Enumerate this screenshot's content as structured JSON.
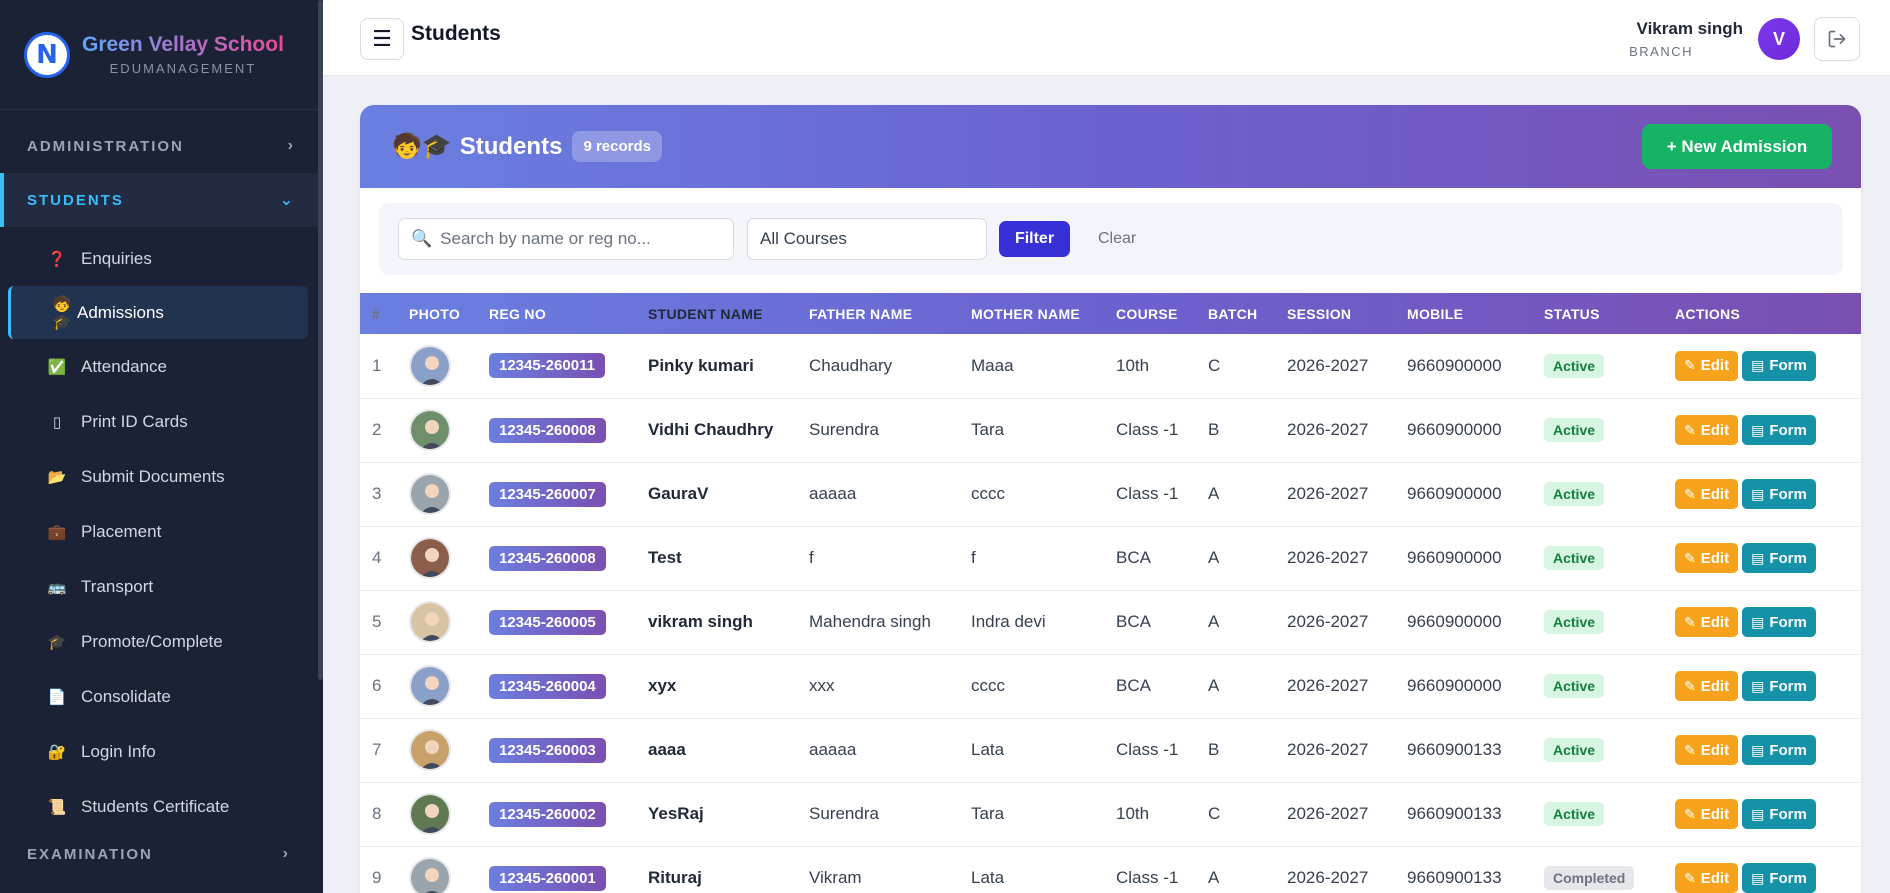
{
  "brand": {
    "name": "Green Vellay School",
    "subtitle": "EDUMANAGEMENT",
    "logo_letter": "N"
  },
  "sidebar": {
    "sections": {
      "administration": "ADMINISTRATION",
      "students": "STUDENTS",
      "examination": "EXAMINATION"
    },
    "items": [
      {
        "label": "Enquiries",
        "icon": "❓"
      },
      {
        "label": "Admissions",
        "icon": "🧒🎓"
      },
      {
        "label": "Attendance",
        "icon": "✅"
      },
      {
        "label": "Print ID Cards",
        "icon": "▯"
      },
      {
        "label": "Submit Documents",
        "icon": "📂"
      },
      {
        "label": "Placement",
        "icon": "💼"
      },
      {
        "label": "Transport",
        "icon": "🚌"
      },
      {
        "label": "Promote/Complete",
        "icon": "🎓"
      },
      {
        "label": "Consolidate",
        "icon": "📄"
      },
      {
        "label": "Login Info",
        "icon": "🔐"
      },
      {
        "label": "Students Certificate",
        "icon": "📜"
      }
    ]
  },
  "topbar": {
    "title": "Students",
    "user_name": "Vikram singh",
    "user_role": "BRANCH",
    "avatar_letter": "V"
  },
  "card": {
    "icon": "🧒🎓",
    "title": "Students",
    "records": "9 records",
    "new_button": "+ New Admission"
  },
  "filters": {
    "search_placeholder": "Search by name or reg no...",
    "course_value": "All Courses",
    "filter_label": "Filter",
    "clear_label": "Clear"
  },
  "table": {
    "headers": [
      "#",
      "Photo",
      "Reg No",
      "Student Name",
      "Father Name",
      "Mother Name",
      "Course",
      "Batch",
      "Session",
      "Mobile",
      "Status",
      "Actions"
    ],
    "edit_label": "Edit",
    "form_label": "Form",
    "rows": [
      {
        "num": "1",
        "reg": "12345-260011",
        "name": "Pinky kumari",
        "father": "Chaudhary",
        "mother": "Maaa",
        "course": "10th",
        "batch": "C",
        "session": "2026-2027",
        "mobile": "9660900000",
        "status": "Active"
      },
      {
        "num": "2",
        "reg": "12345-260008",
        "name": "Vidhi Chaudhry",
        "father": "Surendra",
        "mother": "Tara",
        "course": "Class -1",
        "batch": "B",
        "session": "2026-2027",
        "mobile": "9660900000",
        "status": "Active"
      },
      {
        "num": "3",
        "reg": "12345-260007",
        "name": "GauraV",
        "father": "aaaaa",
        "mother": "cccc",
        "course": "Class -1",
        "batch": "A",
        "session": "2026-2027",
        "mobile": "9660900000",
        "status": "Active"
      },
      {
        "num": "4",
        "reg": "12345-260008",
        "name": "Test",
        "father": "f",
        "mother": "f",
        "course": "BCA",
        "batch": "A",
        "session": "2026-2027",
        "mobile": "9660900000",
        "status": "Active"
      },
      {
        "num": "5",
        "reg": "12345-260005",
        "name": "vikram singh",
        "father": "Mahendra singh",
        "mother": "Indra devi",
        "course": "BCA",
        "batch": "A",
        "session": "2026-2027",
        "mobile": "9660900000",
        "status": "Active"
      },
      {
        "num": "6",
        "reg": "12345-260004",
        "name": "xyx",
        "father": "xxx",
        "mother": "cccc",
        "course": "BCA",
        "batch": "A",
        "session": "2026-2027",
        "mobile": "9660900000",
        "status": "Active"
      },
      {
        "num": "7",
        "reg": "12345-260003",
        "name": "aaaa",
        "father": "aaaaa",
        "mother": "Lata",
        "course": "Class -1",
        "batch": "B",
        "session": "2026-2027",
        "mobile": "9660900133",
        "status": "Active"
      },
      {
        "num": "8",
        "reg": "12345-260002",
        "name": "YesRaj",
        "father": "Surendra",
        "mother": "Tara",
        "course": "10th",
        "batch": "C",
        "session": "2026-2027",
        "mobile": "9660900133",
        "status": "Active"
      },
      {
        "num": "9",
        "reg": "12345-260001",
        "name": "Rituraj",
        "father": "Vikram",
        "mother": "Lata",
        "course": "Class -1",
        "batch": "A",
        "session": "2026-2027",
        "mobile": "9660900133",
        "status": "Completed"
      }
    ]
  },
  "colors": {
    "sidebar_bg": "#1b2236",
    "accent": "#38bdf8",
    "header_gradient_start": "#6a7fe0",
    "header_gradient_end": "#7a4fb2",
    "new_button": "#16b364",
    "edit_button": "#f6a21a",
    "form_button": "#1591a8",
    "active_status": "#15803d"
  }
}
